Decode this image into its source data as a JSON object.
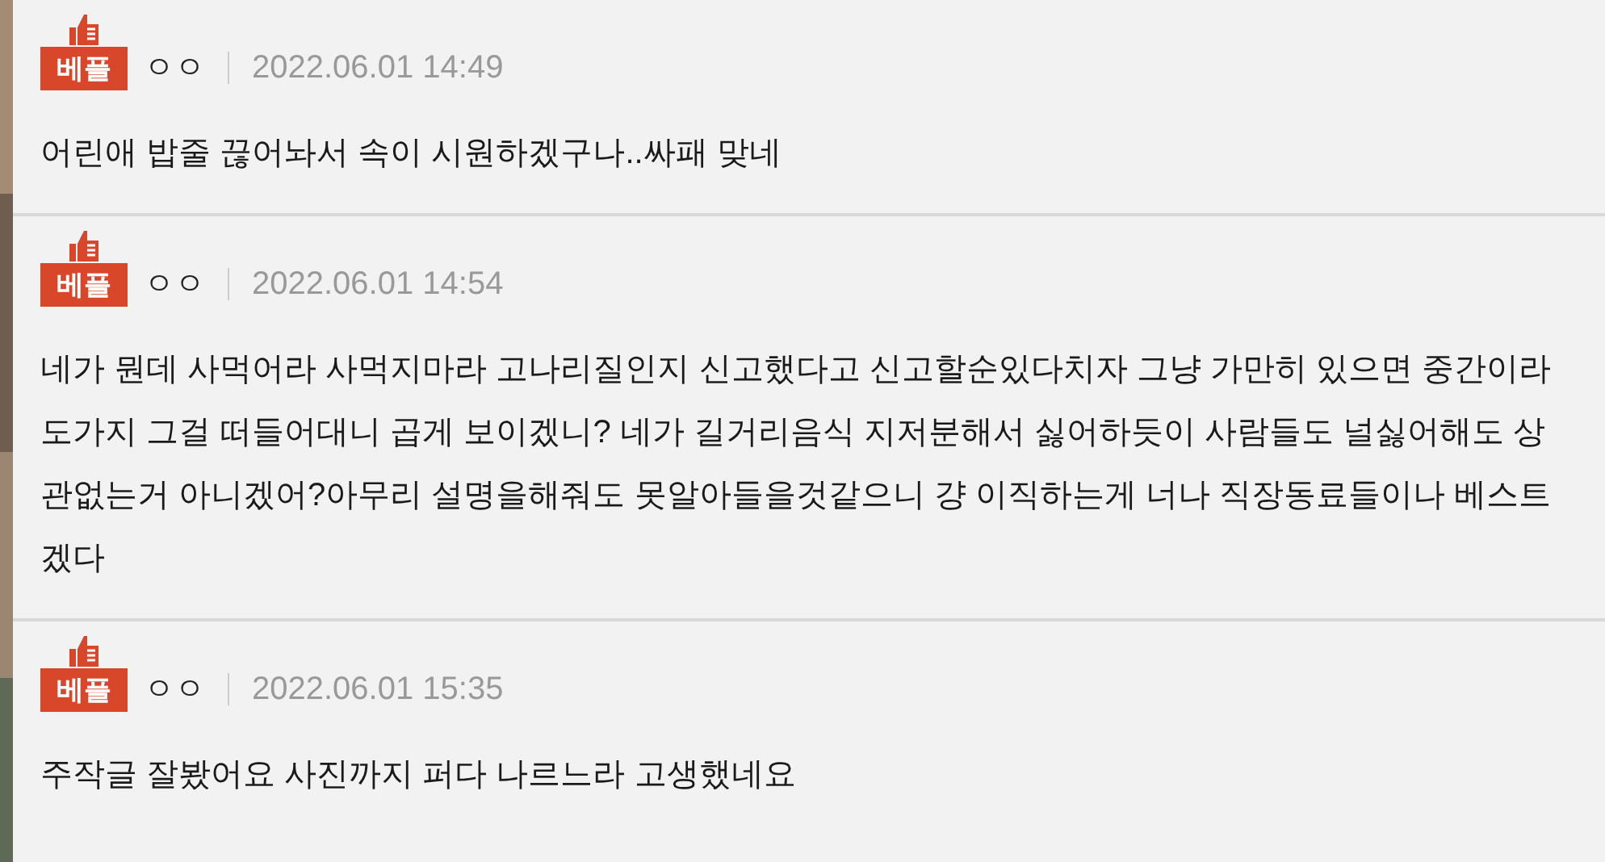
{
  "comments": [
    {
      "badge": "베플",
      "author": "ㅇㅇ",
      "date": "2022.06.01 14:49",
      "text": "어린애 밥줄 끊어놔서 속이 시원하겠구나..싸패 맞네"
    },
    {
      "badge": "베플",
      "author": "ㅇㅇ",
      "date": "2022.06.01 14:54",
      "text": "네가 뭔데 사먹어라 사먹지마라 고나리질인지 신고했다고 신고할순있다치자 그냥 가만히 있으면 중간이라도가지 그걸 떠들어대니 곱게 보이겠니? 네가 길거리음식 지저분해서 싫어하듯이 사람들도 널싫어해도 상관없는거 아니겠어?아무리 설명을해줘도 못알아들을것같으니 걍 이직하는게 너나 직장동료들이나 베스트겠다"
    },
    {
      "badge": "베플",
      "author": "ㅇㅇ",
      "date": "2022.06.01 15:35",
      "text": "주작글 잘봤어요 사진까지 퍼다 나르느라 고생했네요"
    }
  ]
}
